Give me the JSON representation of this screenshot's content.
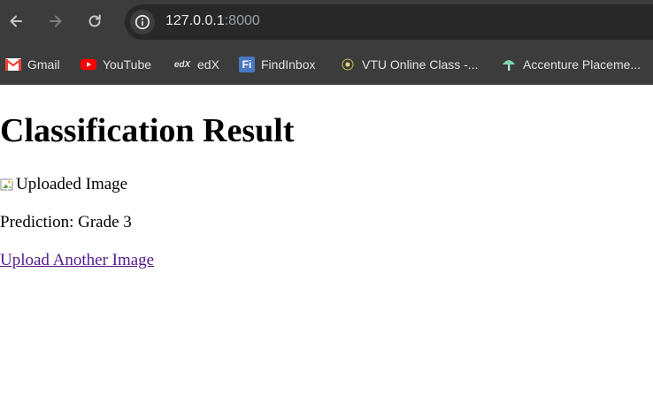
{
  "browser": {
    "url_host": "127.0.0.1",
    "url_port": ":8000",
    "bookmarks": [
      {
        "label": "Gmail",
        "icon": "gmail-icon"
      },
      {
        "label": "YouTube",
        "icon": "youtube-icon"
      },
      {
        "label": "edX",
        "icon": "edx-icon",
        "icon_text": "edX"
      },
      {
        "label": "FindInbox",
        "icon": "findinbox-icon",
        "icon_text": "Fi"
      },
      {
        "label": "VTU Online Class -...",
        "icon": "vtu-icon"
      },
      {
        "label": "Accenture Placeme...",
        "icon": "accenture-icon"
      }
    ]
  },
  "page": {
    "heading": "Classification Result",
    "image_alt": "Uploaded Image",
    "prediction": "Prediction: Grade 3",
    "upload_link": "Upload Another Image"
  },
  "colors": {
    "chrome_bg": "#3c3c3c",
    "omnibox_bg": "#282828",
    "visited_link": "#551a8b",
    "gmail_red": "#ea4335",
    "youtube_red": "#ff0000",
    "findinbox_blue": "#4a78c2"
  }
}
